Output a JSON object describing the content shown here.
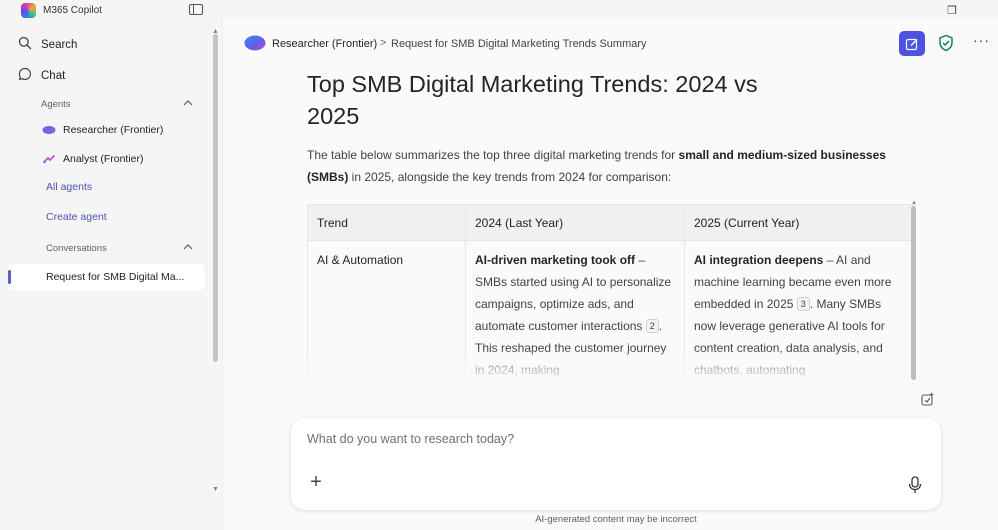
{
  "window": {
    "title": "M365 Copilot",
    "controls": {
      "restore": "❐"
    }
  },
  "sidebar": {
    "search_label": "Search",
    "chat_label": "Chat",
    "agents_label": "Agents",
    "agents": [
      {
        "label": "Researcher (Frontier)"
      },
      {
        "label": "Analyst (Frontier)"
      }
    ],
    "all_agents_label": "All agents",
    "create_agent_label": "Create agent",
    "conversations_label": "Conversations",
    "conversations": [
      {
        "label": "Request for SMB Digital Ma..."
      }
    ]
  },
  "header": {
    "agent_name": "Researcher (Frontier)",
    "separator": ">",
    "conversation_title": "Request for SMB Digital Marketing Trends Summary",
    "more_label": "···"
  },
  "document": {
    "title": "Top SMB Digital Marketing Trends: 2024 vs 2025",
    "intro_before": "The table below summarizes the top three digital marketing trends for ",
    "intro_bold": "small and medium-sized businesses (SMBs)",
    "intro_after": " in 2025, alongside the key trends from 2024 for comparison:",
    "table": {
      "headers": [
        "Trend",
        "2024 (Last Year)",
        "2025 (Current Year)"
      ],
      "rows": [
        {
          "trend": "AI & Automation",
          "y2024_bold": "AI-driven marketing took off",
          "y2024_text": " – SMBs started using AI to personalize campaigns, optimize ads, and automate customer interactions",
          "y2024_cite": "2",
          "y2024_tail": ". This reshaped the customer journey in 2024, making",
          "y2025_bold": "AI integration deepens",
          "y2025_text": " – AI and machine learning became even more embedded in 2025",
          "y2025_cite": "3",
          "y2025_tail": ". Many SMBs now leverage generative AI tools for content creation, data analysis, and chatbots, automating"
        }
      ]
    }
  },
  "composer": {
    "placeholder": "What do you want to research today?",
    "add_label": "+"
  },
  "footer": {
    "disclaimer": "AI-generated content may be incorrect"
  },
  "colors": {
    "accent": "#4f52e0",
    "link": "#4f52b2",
    "shield": "#107c41"
  }
}
